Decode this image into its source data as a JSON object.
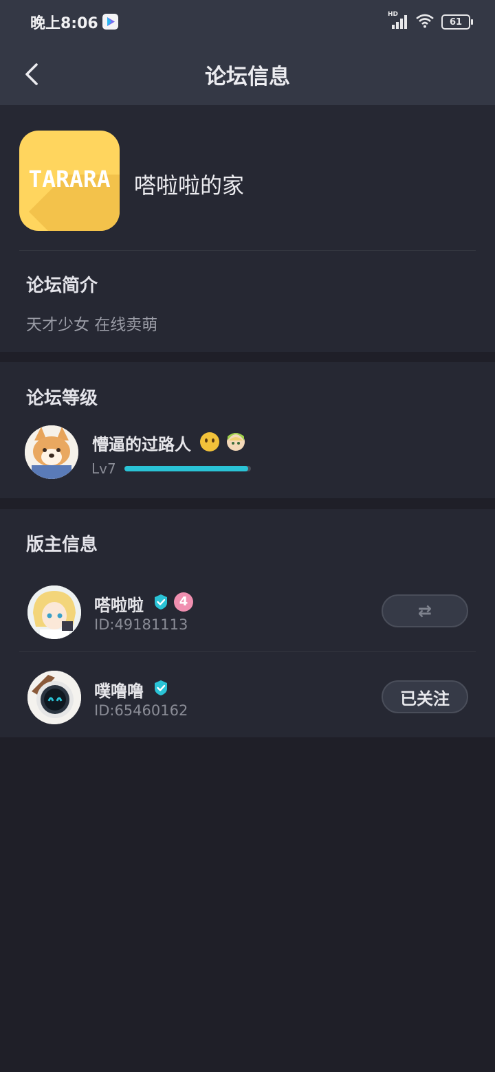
{
  "status_bar": {
    "time": "晚上8:06",
    "network": "HD",
    "battery": "61"
  },
  "header": {
    "title": "论坛信息"
  },
  "forum": {
    "logo_text": "TARARA",
    "name": "嗒啦啦的家",
    "intro_title": "论坛简介",
    "intro": "天才少女 在线卖萌"
  },
  "level": {
    "title": "论坛等级",
    "username": "懵逼的过路人",
    "level_label": "Lv7",
    "progress": 0.98
  },
  "moderators": {
    "title": "版主信息",
    "items": [
      {
        "name": "嗒啦啦",
        "id": "ID:49181113",
        "rank": "4",
        "action": "⇄"
      },
      {
        "name": "噗噜噜",
        "id": "ID:65460162",
        "action": "已关注"
      }
    ]
  },
  "colors": {
    "accent": "#2ac3d6",
    "background": "#1f1f28",
    "card": "#262833",
    "header": "#343845",
    "logo": "#ffd55e",
    "badge": "#f08fb0"
  }
}
